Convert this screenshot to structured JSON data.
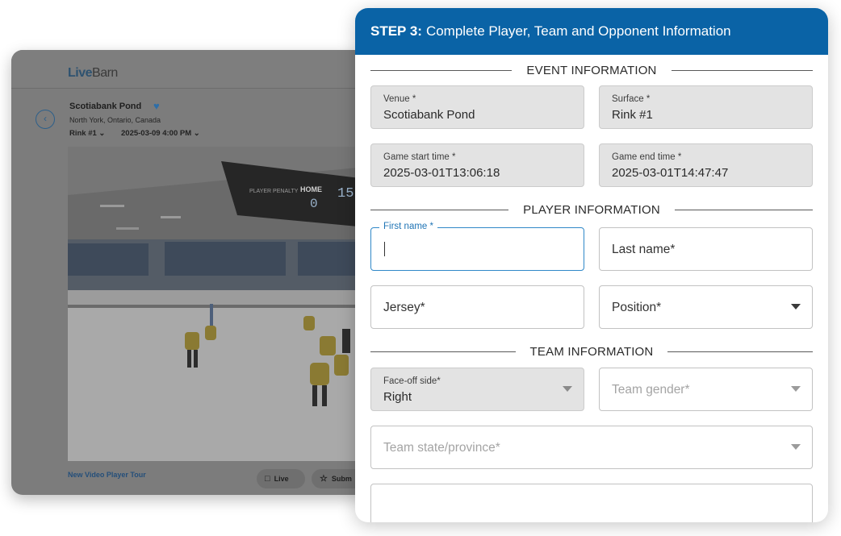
{
  "player_page": {
    "logo": {
      "prefix": "Live",
      "suffix": "Barn"
    },
    "venue_name": "Scotiabank Pond",
    "venue_location": "North York, Ontario, Canada",
    "rink_selector": "Rink #1 ⌄",
    "date_selector": "2025-03-09 4:00 PM ⌄",
    "back_icon": "chevron-left-icon",
    "favorite_icon": "heart-icon",
    "scoreboard": {
      "player_penalty": "PLAYER PENALTY",
      "home": "HOME",
      "home_score": "0",
      "clock": "15:"
    },
    "tour_link": "New Video Player Tour",
    "live_button": "Live",
    "submit_button": "Subm",
    "colors": {
      "card_bg": "#7c7c7c",
      "accent": "#2d6ea8"
    }
  },
  "modal": {
    "header": {
      "step": "STEP 3:",
      "title": "Complete Player, Team and Opponent Information"
    },
    "sections": {
      "event": "EVENT INFORMATION",
      "player": "PLAYER INFORMATION",
      "team": "TEAM INFORMATION"
    },
    "event_fields": {
      "venue": {
        "label": "Venue *",
        "value": "Scotiabank Pond"
      },
      "surface": {
        "label": "Surface *",
        "value": "Rink #1"
      },
      "start_time": {
        "label": "Game start time *",
        "value": "2025-03-01T13:06:18"
      },
      "end_time": {
        "label": "Game end time *",
        "value": "2025-03-01T14:47:47"
      }
    },
    "player_fields": {
      "first_name": {
        "label": "First name *"
      },
      "last_name": {
        "placeholder": "Last name*"
      },
      "jersey": {
        "placeholder": "Jersey*"
      },
      "position": {
        "placeholder": "Position*"
      }
    },
    "team_fields": {
      "faceoff": {
        "label": "Face-off side*",
        "value": "Right"
      },
      "gender": {
        "placeholder": "Team gender*"
      },
      "state": {
        "placeholder": "Team state/province*"
      }
    },
    "colors": {
      "header_bg": "#0a63a6",
      "focus": "#2f88c8",
      "filled_bg": "#e3e3e3"
    }
  }
}
